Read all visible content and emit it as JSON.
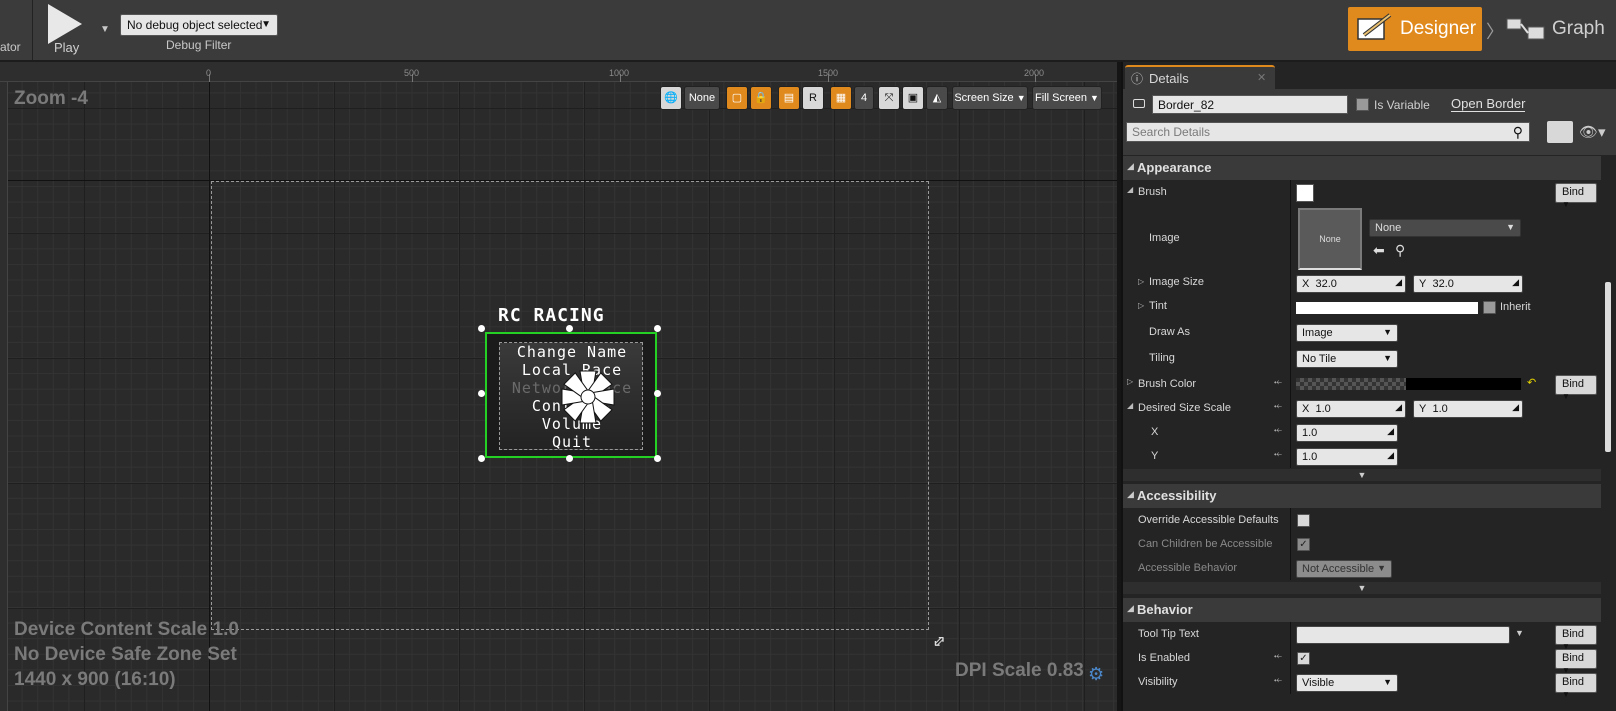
{
  "toolbar": {
    "left_cut_label": "ator",
    "play_label": "Play",
    "debug_object": "No debug object selected",
    "debug_filter_label": "Debug Filter",
    "designer_label": "Designer",
    "graph_label": "Graph"
  },
  "canvas": {
    "zoom": "Zoom -4",
    "ruler": [
      "0",
      "500",
      "1000",
      "1500",
      "2000"
    ],
    "device_content_scale": "Device Content Scale 1.0",
    "safe_zone": "No Device Safe Zone Set",
    "resolution": "1440 x 900 (16:10)",
    "dpi_scale": "DPI Scale 0.83",
    "toolbar": {
      "localization": "None",
      "respect_key": "R",
      "grid_snap": "4",
      "screen_size": "Screen Size",
      "fill_screen": "Fill Screen"
    }
  },
  "widget": {
    "title": "RC RACING",
    "menu": [
      "Change Name",
      "Local Race",
      "Network Race",
      "Controls",
      "Volume",
      "Quit"
    ],
    "disabled_item_index": 2
  },
  "details": {
    "tab_label": "Details",
    "name_value": "Border_82",
    "is_variable_label": "Is Variable",
    "open_link": "Open Border",
    "search_placeholder": "Search Details",
    "appearance": {
      "header": "Appearance",
      "brush_label": "Brush",
      "image_label": "Image",
      "image_thumb": "None",
      "image_combo": "None",
      "image_size_label": "Image Size",
      "image_size_x": "32.0",
      "image_size_y": "32.0",
      "tint_label": "Tint",
      "inherit_label": "Inherit",
      "draw_as_label": "Draw As",
      "draw_as_value": "Image",
      "tiling_label": "Tiling",
      "tiling_value": "No Tile",
      "brush_color_label": "Brush Color",
      "desired_size_label": "Desired Size Scale",
      "dss_x": "1.0",
      "dss_y": "1.0",
      "x_label": "X",
      "y_label": "Y",
      "x_value": "1.0",
      "y_value": "1.0"
    },
    "accessibility": {
      "header": "Accessibility",
      "override_label": "Override Accessible Defaults",
      "children_label": "Can Children be Accessible",
      "behavior_label": "Accessible Behavior",
      "behavior_value": "Not Accessible"
    },
    "behavior": {
      "header": "Behavior",
      "tooltip_label": "Tool Tip Text",
      "enabled_label": "Is Enabled",
      "visibility_label": "Visibility",
      "visibility_value": "Visible"
    },
    "bind_label": "Bind",
    "axis_x": "X",
    "axis_y": "Y"
  },
  "colors": {
    "accent": "#e08a1e",
    "selection_outline": "#25d025",
    "canvas_bg": "#2a2a2a",
    "panel_bg": "#242424"
  }
}
